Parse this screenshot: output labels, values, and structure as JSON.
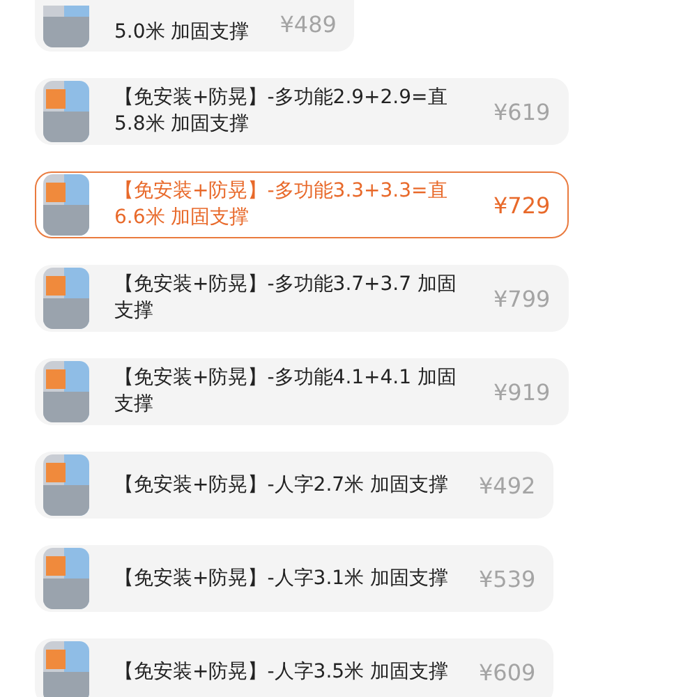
{
  "options": [
    {
      "title": "5.0米 加固支撑",
      "price": "¥489",
      "selected": false,
      "cut": true
    },
    {
      "title": "【免安装+防晃】-多功能2.9+2.9=直5.8米 加固支撑",
      "price": "¥619",
      "selected": false
    },
    {
      "title": "【免安装+防晃】-多功能3.3+3.3=直6.6米 加固支撑",
      "price": "¥729",
      "selected": true
    },
    {
      "title": "【免安装+防晃】-多功能3.7+3.7 加固支撑",
      "price": "¥799",
      "selected": false
    },
    {
      "title": "【免安装+防晃】-多功能4.1+4.1 加固支撑",
      "price": "¥919",
      "selected": false
    },
    {
      "title": "【免安装+防晃】-人字2.7米 加固支撑",
      "price": "¥492",
      "selected": false
    },
    {
      "title": "【免安装+防晃】-人字3.1米 加固支撑",
      "price": "¥539",
      "selected": false
    },
    {
      "title": "【免安装+防晃】-人字3.5米 加固支撑",
      "price": "¥609",
      "selected": false
    }
  ]
}
